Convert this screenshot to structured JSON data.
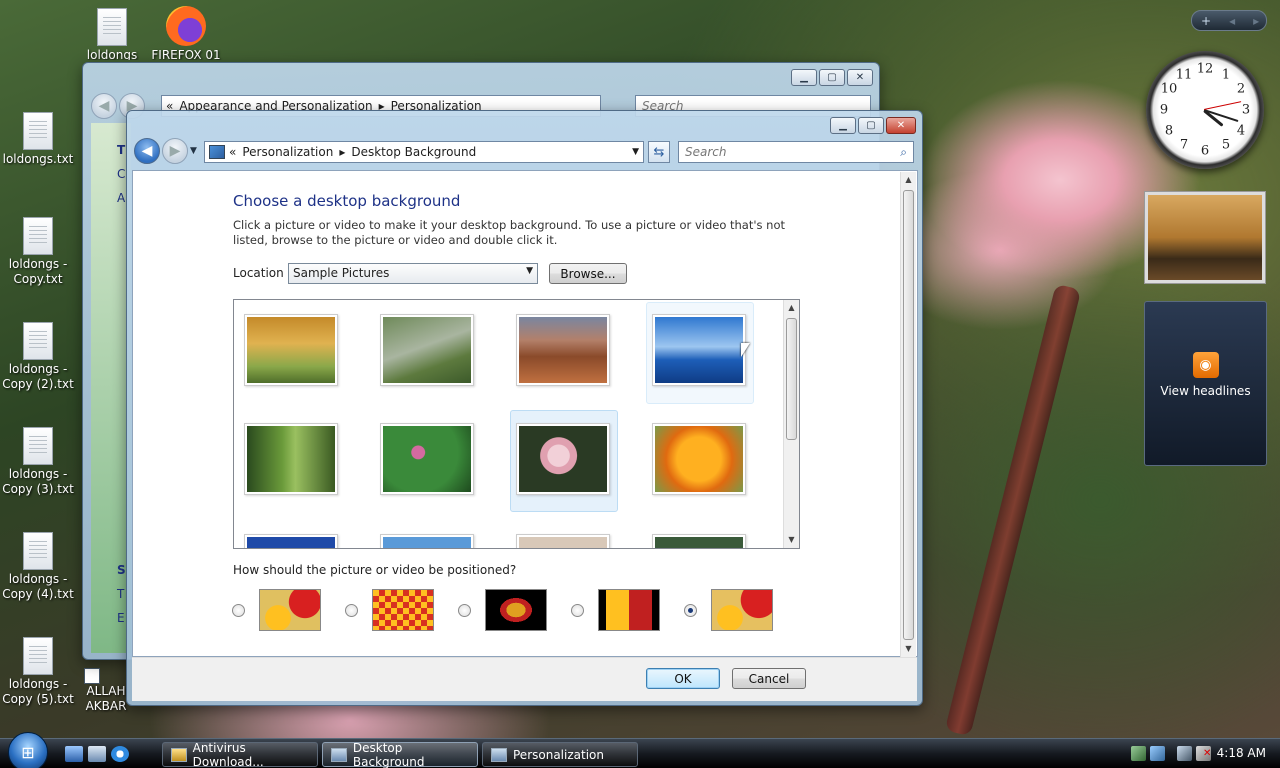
{
  "desktop": {
    "icons": [
      {
        "label": "loldongs.txt"
      },
      {
        "label": "loldongs - Copy.txt"
      },
      {
        "label": "loldongs - Copy (2).txt"
      },
      {
        "label": "loldongs - Copy (3).txt"
      },
      {
        "label": "loldongs - Copy (4).txt"
      },
      {
        "label": "loldongs - Copy (5).txt"
      },
      {
        "label": "loldongs"
      },
      {
        "label": "FIREFOX 01"
      },
      {
        "label": "ALLAH AKBAR"
      }
    ]
  },
  "back_window": {
    "breadcrumb": [
      "«",
      "Appearance and Personalization",
      "Personalization"
    ],
    "search_placeholder": "Search",
    "left_fragments": [
      "T",
      "C",
      "A",
      "S",
      "T",
      "E"
    ]
  },
  "dialog": {
    "breadcrumb": [
      "«",
      "Personalization",
      "Desktop Background"
    ],
    "search_placeholder": "Search",
    "heading": "Choose a desktop background",
    "description": "Click a picture or video to make it your desktop background. To use a picture or video that's not listed, browse to the picture or video and double click it.",
    "location_label": "Location",
    "location_value": "Sample Pictures",
    "browse_label": "Browse...",
    "position_question": "How should the picture or video be positioned?",
    "position_options": [
      {
        "name": "fit-to-screen",
        "selected": false
      },
      {
        "name": "tile",
        "selected": false
      },
      {
        "name": "center",
        "selected": false
      },
      {
        "name": "fit-letterbox",
        "selected": false
      },
      {
        "name": "stretch",
        "selected": true
      }
    ],
    "ok_label": "OK",
    "cancel_label": "Cancel",
    "selected_thumbnail": "pink-flowers",
    "thumbnails": [
      "autumn-tree",
      "stream-meadow",
      "desert-rocks",
      "ocean-boat",
      "forest-path",
      "green-leaves-flowers",
      "pink-flowers",
      "orange-daisies"
    ]
  },
  "gadgets": {
    "rss_label": "View headlines",
    "clock_numbers": [
      "12",
      "1",
      "2",
      "3",
      "4",
      "5",
      "6",
      "7",
      "8",
      "9",
      "10",
      "11"
    ],
    "sidebar_top": [
      "+",
      "◂",
      "▸"
    ]
  },
  "taskbar": {
    "start_glyph": "⊞",
    "buttons": [
      {
        "label": "Antivirus Download..."
      },
      {
        "label": "Desktop Background"
      },
      {
        "label": "Personalization"
      }
    ],
    "clock": "4:18 AM"
  },
  "colors": {
    "heading_blue": "#1e3287",
    "selection_bg": "#e5f1fb"
  }
}
